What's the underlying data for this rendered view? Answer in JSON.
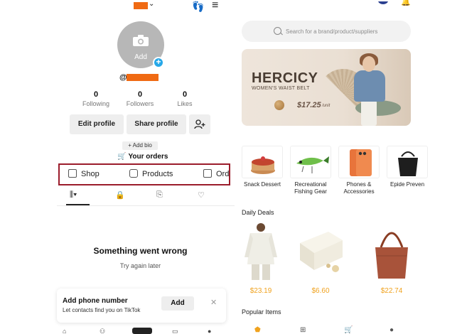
{
  "profile": {
    "add_photo_label": "Add",
    "handle_prefix": "@",
    "stats": [
      {
        "value": "0",
        "label": "Following"
      },
      {
        "value": "0",
        "label": "Followers"
      },
      {
        "value": "0",
        "label": "Likes"
      }
    ],
    "edit_profile": "Edit profile",
    "share_profile": "Share profile",
    "add_bio": "+ Add bio",
    "your_orders": "Your orders",
    "shop_tabs": [
      "Shop",
      "Products",
      "Orders"
    ]
  },
  "error": {
    "title": "Something went wrong",
    "subtitle": "Try again later"
  },
  "phone_card": {
    "title": "Add phone number",
    "subtitle": "Let contacts find you on TikTok",
    "add": "Add",
    "close": "✕"
  },
  "shop": {
    "search_placeholder": "Search for a brand/product/suppliers",
    "banner": {
      "brand": "HERCICY",
      "subtitle": "WOMEN'S WAIST BELT",
      "price": "$17.25",
      "unit": "/unit"
    },
    "categories": [
      {
        "label": "Snack Dessert",
        "icon": "cake-icon"
      },
      {
        "label": "Recreational Fishing Gear",
        "icon": "fishing-lure-icon"
      },
      {
        "label": "Phones & Accessories",
        "icon": "phone-icon"
      },
      {
        "label": "Epide Preven",
        "icon": "bag-icon"
      }
    ],
    "daily_deals_title": "Daily Deals",
    "deals": [
      {
        "price": "$23.19",
        "icon": "shirt-icon"
      },
      {
        "price": "$6.60",
        "icon": "gift-box-icon"
      },
      {
        "price": "$22.74",
        "icon": "handbag-icon"
      }
    ],
    "popular_items_title": "Popular Items"
  },
  "colors": {
    "accent_orange": "#f06a13",
    "highlight_border": "#9b1c2b",
    "price": "#f0a21e",
    "avatar_plus": "#27a8e8"
  }
}
